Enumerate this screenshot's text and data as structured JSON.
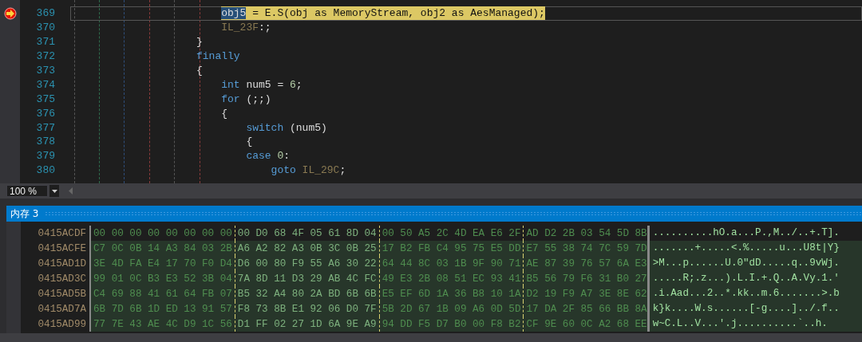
{
  "editor": {
    "lines": [
      {
        "number": "369",
        "current": true,
        "breakpoint": true,
        "tokens": [
          {
            "kind": "selected",
            "text": "                        obj5"
          },
          {
            "kind": "plain",
            "text": " = E.S(obj as MemoryStream, obj2 as AesManaged);"
          }
        ]
      },
      {
        "number": "370",
        "current": false,
        "breakpoint": false,
        "tokens": [
          {
            "kind": "label",
            "text": "                        IL_23F"
          },
          {
            "kind": "plain",
            "text": ":;"
          }
        ]
      },
      {
        "number": "371",
        "current": false,
        "breakpoint": false,
        "tokens": [
          {
            "kind": "plain",
            "text": "                    }"
          }
        ]
      },
      {
        "number": "372",
        "current": false,
        "breakpoint": false,
        "tokens": [
          {
            "kind": "keyword",
            "text": "                    finally"
          }
        ]
      },
      {
        "number": "373",
        "current": false,
        "breakpoint": false,
        "tokens": [
          {
            "kind": "plain",
            "text": "                    {"
          }
        ]
      },
      {
        "number": "374",
        "current": false,
        "breakpoint": false,
        "tokens": [
          {
            "kind": "keyword",
            "text": "                        int"
          },
          {
            "kind": "plain",
            "text": " num5 = "
          },
          {
            "kind": "number",
            "text": "6"
          },
          {
            "kind": "plain",
            "text": ";"
          }
        ]
      },
      {
        "number": "375",
        "current": false,
        "breakpoint": false,
        "tokens": [
          {
            "kind": "keyword",
            "text": "                        for"
          },
          {
            "kind": "plain",
            "text": " (;;)"
          }
        ]
      },
      {
        "number": "376",
        "current": false,
        "breakpoint": false,
        "tokens": [
          {
            "kind": "plain",
            "text": "                        {"
          }
        ]
      },
      {
        "number": "377",
        "current": false,
        "breakpoint": false,
        "tokens": [
          {
            "kind": "keyword",
            "text": "                            switch"
          },
          {
            "kind": "plain",
            "text": " (num5)"
          }
        ]
      },
      {
        "number": "378",
        "current": false,
        "breakpoint": false,
        "tokens": [
          {
            "kind": "plain",
            "text": "                            {"
          }
        ]
      },
      {
        "number": "379",
        "current": false,
        "breakpoint": false,
        "tokens": [
          {
            "kind": "keyword",
            "text": "                            case "
          },
          {
            "kind": "number",
            "text": "0"
          },
          {
            "kind": "plain",
            "text": ":"
          }
        ]
      },
      {
        "number": "380",
        "current": false,
        "breakpoint": false,
        "tokens": [
          {
            "kind": "keyword",
            "text": "                                goto "
          },
          {
            "kind": "label",
            "text": "IL_29C"
          },
          {
            "kind": "plain",
            "text": ";"
          }
        ]
      }
    ],
    "zoom": "100 %"
  },
  "memory": {
    "title": "内存 3",
    "rows": [
      {
        "address": "0415ACDF",
        "highlighted": false,
        "groups": [
          "00 00 00 00 00 00 00 00",
          "00 D0 68 4F 05 61 8D 04",
          "00 50 A5 2C 4D EA E6 2F",
          "AD D2 2B 03 54 5D 8B"
        ],
        "ascii": "..........hO.a...P.,M../..+.T]."
      },
      {
        "address": "0415ACFE",
        "highlighted": true,
        "groups": [
          "C7 0C 0B 14 A3 84 03 2B",
          "A6 A2 82 A3 0B 3C 0B 25",
          "17 B2 FB C4 95 75 E5 DD",
          "E7 55 38 74 7C 59 7D"
        ],
        "ascii": ".......+.....<.%.....u...U8t|Y}"
      },
      {
        "address": "0415AD1D",
        "highlighted": true,
        "groups": [
          "3E 4D FA E4 17 70 F0 D4",
          "D6 00 80 F9 55 A6 30 22",
          "64 44 8C 03 1B 9F 90 71",
          "AE 87 39 76 57 6A E3"
        ],
        "ascii": ">M...p......U.0\"dD.....q..9vWj."
      },
      {
        "address": "0415AD3C",
        "highlighted": true,
        "groups": [
          "99 01 0C B3 E3 52 3B 04",
          "7A 8D 11 D3 29 AB 4C FC",
          "49 E3 2B 08 51 EC 93 41",
          "B5 56 79 F6 31 B0 27"
        ],
        "ascii": ".....R;.z...).L.I.+.Q..A.Vy.1.'"
      },
      {
        "address": "0415AD5B",
        "highlighted": true,
        "groups": [
          "C4 69 88 41 61 64 FB 07",
          "B5 32 A4 80 2A BD 6B 6B",
          "E5 EF 6D 1A 36 B8 10 1A",
          "D2 19 F9 A7 3E 8E 62"
        ],
        "ascii": ".i.Aad...2..*.kk..m.6.......>.b"
      },
      {
        "address": "0415AD7A",
        "highlighted": true,
        "groups": [
          "6B 7D 6B 1D ED 13 91 57",
          "F8 73 8B E1 92 06 D0 7F",
          "5B 2D 67 1B 09 A6 0D 5D",
          "17 DA 2F 85 66 BB 8A"
        ],
        "ascii": "k}k....W.s......[-g....]../.f.."
      },
      {
        "address": "0415AD99",
        "highlighted": true,
        "groups": [
          "77 7E 43 AE 4C D9 1C 56",
          "D1 FF 02 27 1D 6A 9E A9",
          "94 DD F5 D7 B0 00 F8 B2",
          "CF 9E 60 0C A2 68 EE"
        ],
        "ascii": "w~C.L..V...'.j..........`..h."
      }
    ]
  }
}
